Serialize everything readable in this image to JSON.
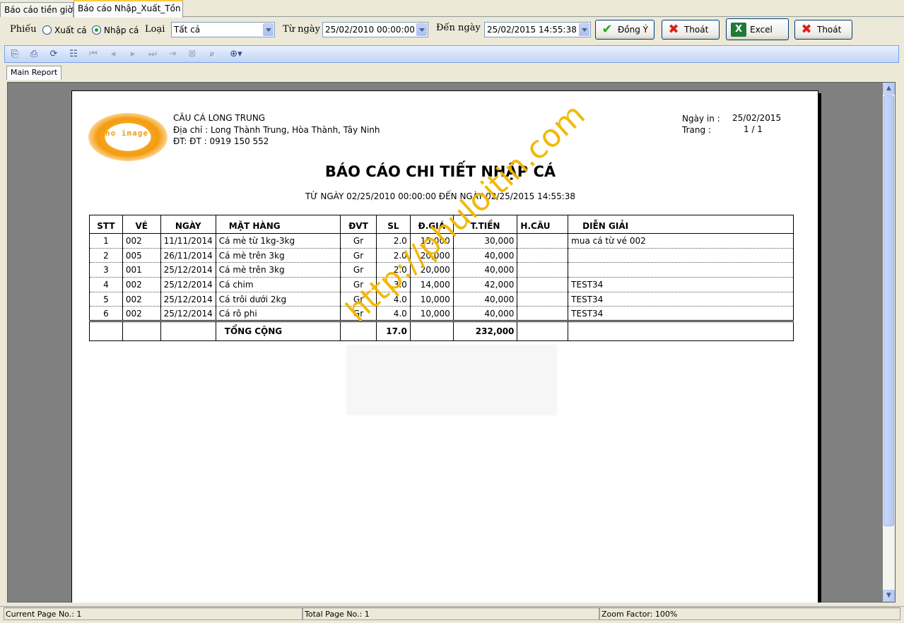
{
  "tabs": [
    {
      "label": "Báo cáo tiền giờ"
    },
    {
      "label": "Báo cáo Nhập_Xuất_Tồn"
    }
  ],
  "filter": {
    "phieu_label": "Phiếu",
    "radio_xuat": "Xuất cá",
    "radio_nhap": "Nhập cá",
    "selected_radio": "Nhập cá",
    "loai_label": "Loại",
    "loai_value": "Tất cả",
    "tu_ngay_label": "Từ ngày",
    "tu_ngay_value": "25/02/2010 00:00:00",
    "den_ngay_label": "Đến ngày",
    "den_ngay_value": "25/02/2015 14:55:38",
    "buttons": {
      "ok": "Đồng Ý",
      "exit1": "Thoát",
      "excel": "Excel",
      "exit2": "Thoát"
    }
  },
  "viewer": {
    "subtab": "Main Report",
    "toolbar_icons": [
      "export-icon",
      "print-icon",
      "refresh-icon",
      "group-tree-icon",
      "first-page-icon",
      "prev-page-icon",
      "next-page-icon",
      "last-page-icon",
      "goto-page-icon",
      "close-view-icon",
      "search-icon",
      "zoom-icon"
    ]
  },
  "report": {
    "company": "CÂU CÁ LONG TRUNG",
    "address": "Địa chỉ : Long Thành Trung, Hòa Thành, Tây Ninh",
    "phone": "ĐT: ĐT : 0919 150 552",
    "logo_text": "no image",
    "print_date_label": "Ngày in :",
    "print_date": "25/02/2015",
    "page_label": "Trang :",
    "page_value": "1 / 1",
    "title": "BÁO CÁO CHI TIẾT NHẬP CÁ",
    "subtitle": "TỪ NGÀY 02/25/2010 00:00:00 ĐẾN NGÀY 02/25/2015 14:55:38",
    "columns": [
      "STT",
      "VÉ",
      "NGÀY",
      "MẶT HÀNG",
      "ĐVT",
      "SL",
      "Đ.GIÁ",
      "T.TIỀN",
      "H.CÂU",
      "DIỄN GIẢI"
    ],
    "rows": [
      [
        "1",
        "002",
        "11/11/2014",
        "Cá mè từ 1kg-3kg",
        "Gr",
        "2.0",
        "15,000",
        "30,000",
        "",
        "mua cá từ vé 002"
      ],
      [
        "2",
        "005",
        "26/11/2014",
        "Cá mè trên 3kg",
        "Gr",
        "2.0",
        "20,000",
        "40,000",
        "",
        ""
      ],
      [
        "3",
        "001",
        "25/12/2014",
        "Cá mè trên 3kg",
        "Gr",
        "2.0",
        "20,000",
        "40,000",
        "",
        ""
      ],
      [
        "4",
        "002",
        "25/12/2014",
        "Cá chim",
        "Gr",
        "3.0",
        "14,000",
        "42,000",
        "",
        "TEST34"
      ],
      [
        "5",
        "002",
        "25/12/2014",
        "Cá trôi dưới 2kg",
        "Gr",
        "4.0",
        "10,000",
        "40,000",
        "",
        "TEST34"
      ],
      [
        "6",
        "002",
        "25/12/2014",
        "Cá rô phi",
        "Gr",
        "4.0",
        "10,000",
        "40,000",
        "",
        "TEST34"
      ]
    ],
    "total_label": "TỔNG CỘNG",
    "total_sl": "17.0",
    "total_amount": "232,000",
    "watermark": "http://phuloitin.com"
  },
  "status": {
    "current_page": "Current Page No.: 1",
    "total_page": "Total Page No.: 1",
    "zoom": "Zoom Factor: 100%"
  }
}
